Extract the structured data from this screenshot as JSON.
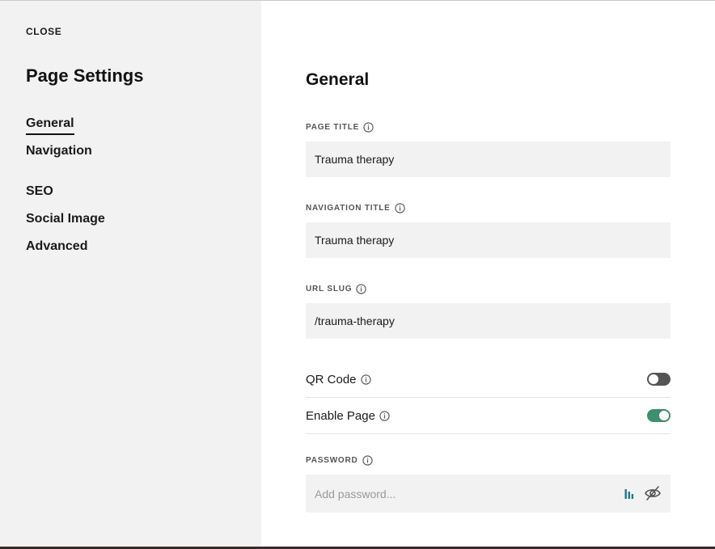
{
  "sidebar": {
    "close_label": "CLOSE",
    "title": "Page Settings",
    "items": [
      {
        "label": "General",
        "active": true
      },
      {
        "label": "Navigation"
      },
      {
        "label": "SEO"
      },
      {
        "label": "Social Image"
      },
      {
        "label": "Advanced"
      }
    ]
  },
  "main": {
    "section_title": "General",
    "page_title": {
      "label": "PAGE TITLE",
      "value": "Trauma therapy"
    },
    "navigation_title": {
      "label": "NAVIGATION TITLE",
      "value": "Trauma therapy"
    },
    "url_slug": {
      "label": "URL SLUG",
      "value": "/trauma-therapy"
    },
    "qr_code": {
      "label": "QR Code",
      "enabled": false
    },
    "enable_page": {
      "label": "Enable Page",
      "enabled": true
    },
    "password": {
      "label": "PASSWORD",
      "placeholder": "Add password...",
      "value": ""
    }
  },
  "icons": {
    "info": "info-icon",
    "password_manager": "password-manager-icon",
    "visibility": "eye-slash-icon"
  },
  "colors": {
    "sidebar_bg": "#f2f2f2",
    "input_bg": "#f2f2f2",
    "toggle_on": "#3d8f6e",
    "toggle_off": "#555555",
    "pw_manager": "#1d7a8c"
  }
}
